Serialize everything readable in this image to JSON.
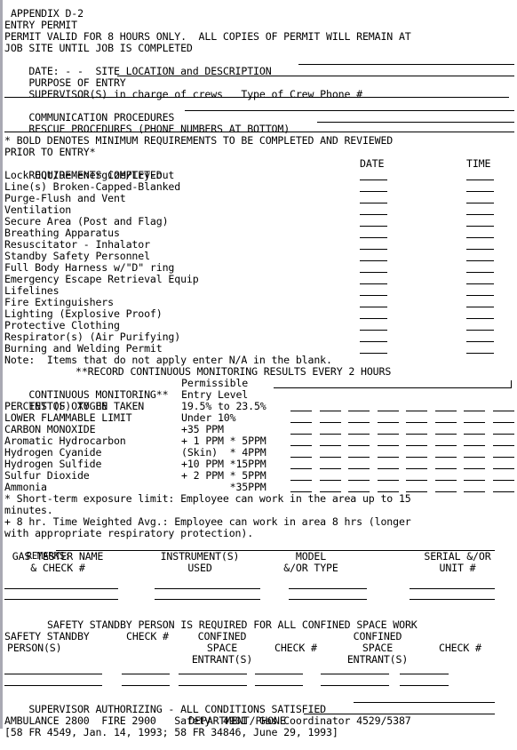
{
  "header": {
    "appendix": "APPENDIX D-2",
    "title": "ENTRY PERMIT",
    "validity_line1": "PERMIT VALID FOR 8 HOURS ONLY.  ALL COPIES OF PERMIT WILL REMAIN AT",
    "validity_line2": "JOB SITE UNTIL JOB IS COMPLETED"
  },
  "fields": {
    "date_label": "DATE: - -  SITE LOCATION and DESCRIPTION",
    "purpose_label": "PURPOSE OF ENTRY",
    "supervisor_label": "SUPERVISOR(S) in charge of crews   Type of Crew Phone #",
    "communication_label": "COMMUNICATION PROCEDURES",
    "rescue_label": "RESCUE PROCEDURES (PHONE NUMBERS AT BOTTOM)"
  },
  "requirements": {
    "note_line1": "* BOLD DENOTES MINIMUM REQUIREMENTS TO BE COMPLETED AND REVIEWED",
    "note_line2": "PRIOR TO ENTRY*",
    "header_label": "REQUIREMENTS COMPLETED",
    "date_header": "DATE",
    "time_header": "TIME",
    "items": [
      "Lock Out/De-energize/Try-out",
      "Line(s) Broken-Capped-Blanked",
      "Purge-Flush and Vent",
      "Ventilation",
      "Secure Area (Post and Flag)",
      "Breathing Apparatus",
      "Resuscitator - Inhalator",
      "Standby Safety Personnel",
      "Full Body Harness w/\"D\" ring",
      "Emergency Escape Retrieval Equip",
      "Lifelines",
      "Fire Extinguishers",
      "Lighting (Explosive Proof)",
      "Protective Clothing",
      "Respirator(s) (Air Purifying)",
      "Burning and Welding Permit"
    ],
    "na_note": "Note:  Items that do not apply enter N/A in the blank."
  },
  "monitoring": {
    "record_note": "**RECORD CONTINUOUS MONITORING RESULTS EVERY 2 HOURS",
    "header1_left": "CONTINUOUS MONITORING**",
    "header1_right": "Permissible",
    "header2_left": "TEST(S) TO BE TAKEN",
    "header2_right": "Entry Level",
    "tests": [
      {
        "name": "PERCENT OF OXYGEN",
        "level": "19.5% to 23.5%"
      },
      {
        "name": "LOWER FLAMMABLE LIMIT",
        "level": "Under 10%"
      },
      {
        "name": "CARBON MONOXIDE",
        "level": "+35 PPM"
      },
      {
        "name": "Aromatic Hydrocarbon",
        "level": "+ 1 PPM * 5PPM"
      },
      {
        "name": "Hydrogen Cyanide",
        "level": "(Skin)  * 4PPM"
      },
      {
        "name": "Hydrogen Sulfide",
        "level": "+10 PPM *15PPM"
      },
      {
        "name": "Sulfur Dioxide",
        "level": "+ 2 PPM * 5PPM"
      },
      {
        "name": "Ammonia",
        "level": "        *35PPM"
      }
    ],
    "stel_note_line1": "* Short-term exposure limit: Employee can work in the area up to 15",
    "stel_note_line2": "minutes.",
    "twa_note_line1": "+ 8 hr. Time Weighted Avg.: Employee can work in area 8 hrs (longer",
    "twa_note_line2": "with appropriate respiratory protection).",
    "remarks_label": "REMARKS:"
  },
  "gas_tester": {
    "columns": [
      {
        "line1": "GAS TESTER NAME",
        "line2": "& CHECK #"
      },
      {
        "line1": "INSTRUMENT(S)",
        "line2": "USED"
      },
      {
        "line1": "MODEL",
        "line2": "&/OR TYPE"
      },
      {
        "line1": "SERIAL &/OR",
        "line2": "UNIT #"
      }
    ]
  },
  "standby": {
    "notice": "SAFETY STANDBY PERSON IS REQUIRED FOR ALL CONFINED SPACE WORK",
    "columns": [
      {
        "line1": "SAFETY STANDBY",
        "line2": "PERSON(S)",
        "line3": ""
      },
      {
        "line1": "CHECK #",
        "line2": "",
        "line3": ""
      },
      {
        "line1": "CONFINED",
        "line2": "SPACE",
        "line3": "ENTRANT(S)"
      },
      {
        "line1": "",
        "line2": "CHECK #",
        "line3": ""
      },
      {
        "line1": "CONFINED",
        "line2": "SPACE",
        "line3": "ENTRANT(S)"
      },
      {
        "line1": "",
        "line2": "CHECK #",
        "line3": ""
      }
    ]
  },
  "authorization": {
    "supervisor_label": "SUPERVISOR AUTHORIZING - ALL CONDITIONS SATISFIED",
    "department_label": "DEPARTMENT/PHONE"
  },
  "footer": {
    "phones": "AMBULANCE 2800  FIRE 2900   Safety  4901  Gas Coordinator 4529/5387",
    "citation": "[58 FR 4549, Jan. 14, 1993; 58 FR 34846, June 29, 1993]"
  }
}
